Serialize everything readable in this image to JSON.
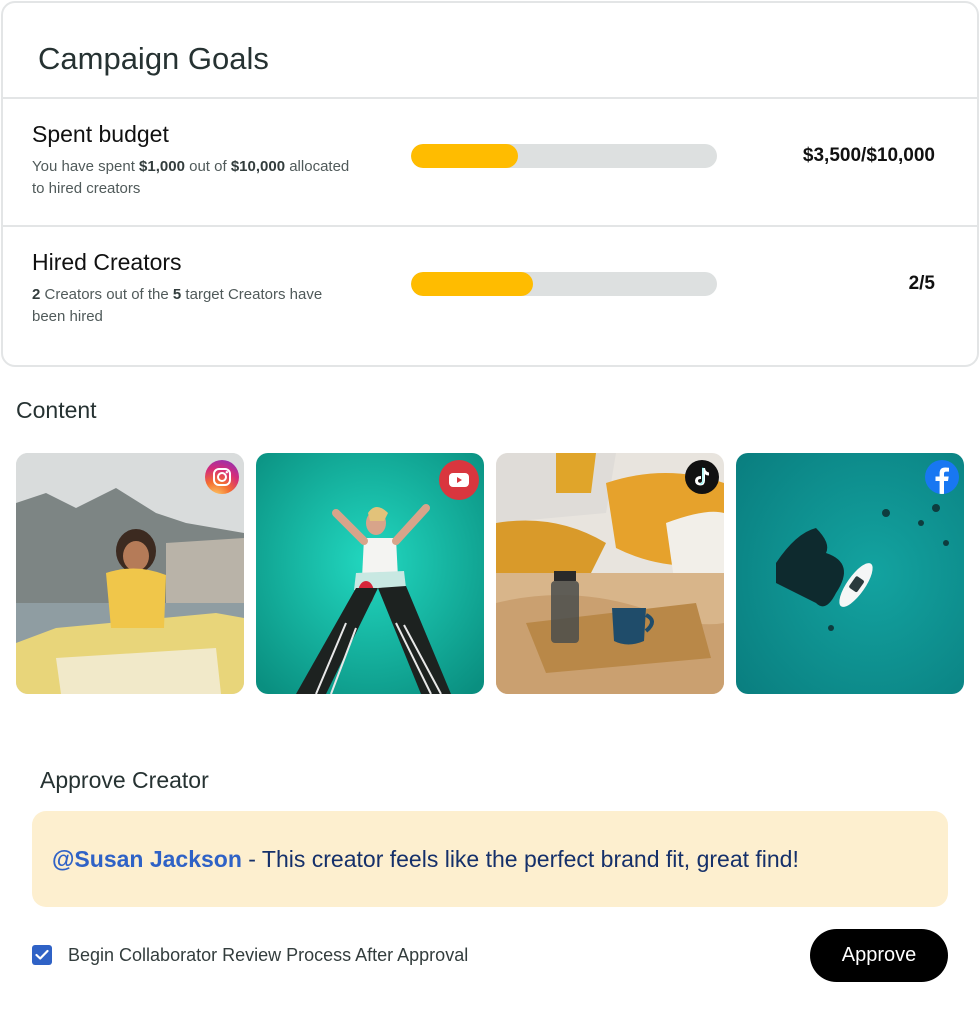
{
  "goals": {
    "title": "Campaign Goals",
    "items": [
      {
        "heading": "Spent budget",
        "desc_prefix": "You have spent ",
        "desc_strong1": "$1,000",
        "desc_mid": " out of ",
        "desc_strong2": "$10,000",
        "desc_suffix": " allocated to hired creators",
        "value": "$3,500/$10,000",
        "progress": 0.35
      },
      {
        "heading": "Hired Creators",
        "desc_prefix": "",
        "desc_strong1": "2",
        "desc_mid": " Creators out of the ",
        "desc_strong2": "5",
        "desc_suffix": " target Creators have been hired",
        "value": "2/5",
        "progress": 0.4
      }
    ],
    "progress_color": "#ffbc00",
    "track_color": "#dde0e0"
  },
  "content": {
    "title": "Content",
    "tiles": [
      {
        "platform": "instagram",
        "icon": "instagram-icon"
      },
      {
        "platform": "youtube",
        "icon": "youtube-icon"
      },
      {
        "platform": "tiktok",
        "icon": "tiktok-icon"
      },
      {
        "platform": "facebook",
        "icon": "facebook-icon"
      }
    ]
  },
  "approve": {
    "title": "Approve Creator",
    "mention": "@Susan Jackson",
    "comment": " - This creator feels like the perfect brand fit, great find!",
    "checkbox_label": "Begin Collaborator Review Process After Approval",
    "checkbox_checked": true,
    "button_label": "Approve"
  }
}
